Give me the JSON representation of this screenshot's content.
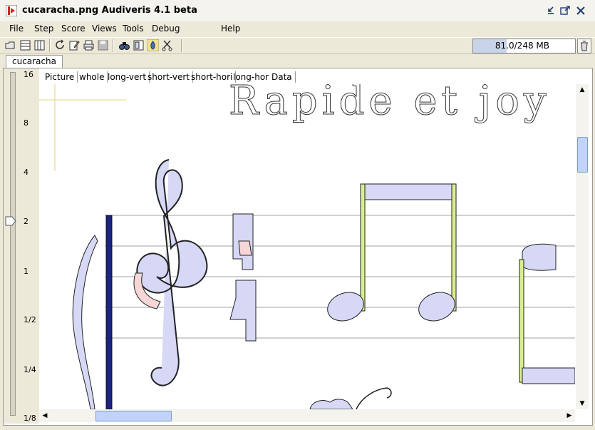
{
  "window": {
    "title": "cucaracha.png Audiveris 4.1 beta"
  },
  "menu": {
    "items": [
      "File",
      "Step",
      "Score",
      "Views",
      "Tools",
      "Debug",
      "Help"
    ]
  },
  "memory": {
    "text": "81.0/248 MB",
    "used_fraction": 0.327
  },
  "sheet_tab": {
    "label": "cucaracha"
  },
  "zoom": {
    "labels": [
      "16",
      "8",
      "4",
      "2",
      "1",
      "1/2",
      "1/4",
      "1/8"
    ]
  },
  "view_tabs": [
    "Picture",
    "whole",
    "long-vert",
    "short-vert",
    "short-hori",
    "long-hori",
    "Data"
  ],
  "active_view_tab": "Data",
  "score_text": {
    "heading": "Rapide  et  joy"
  },
  "colors": {
    "glyph_fill": "#D6D8F6",
    "stem": "#D8F08C",
    "barline": "#1A237E",
    "staff": "#A0A0A0",
    "accent": "#E6D27A"
  }
}
